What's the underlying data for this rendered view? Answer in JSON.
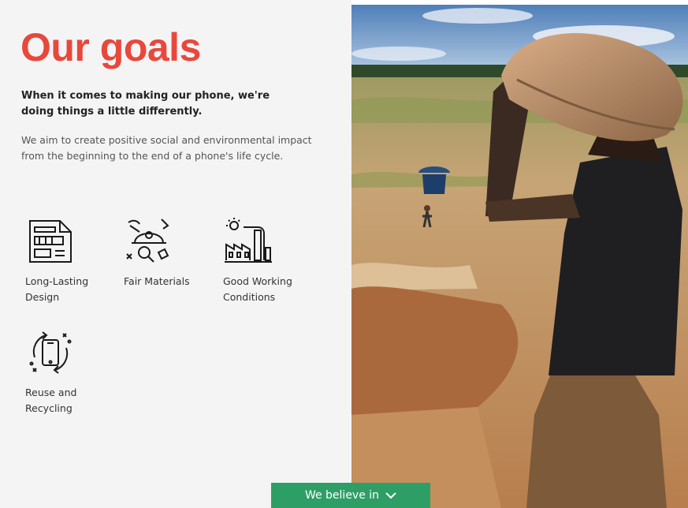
{
  "header": {
    "title": "Our goals"
  },
  "intro": {
    "lead": "When it comes to making our phone, we're doing things a little differently.",
    "description": "We aim to create positive social and environmental impact from the beginning to the end of a phone's life cycle."
  },
  "goals": [
    {
      "label": "Long-Lasting Design",
      "icon": "design-blueprint-icon"
    },
    {
      "label": "Fair Materials",
      "icon": "mining-helmet-icon"
    },
    {
      "label": "Good Working Conditions",
      "icon": "factory-icon"
    },
    {
      "label": "Reuse and Recycling",
      "icon": "phone-recycling-icon"
    }
  ],
  "cta": {
    "label": "We believe in",
    "icon": "chevron-down-icon",
    "color": "#2e9e67"
  },
  "colors": {
    "accent": "#e8483b",
    "background": "#f4f4f5"
  }
}
